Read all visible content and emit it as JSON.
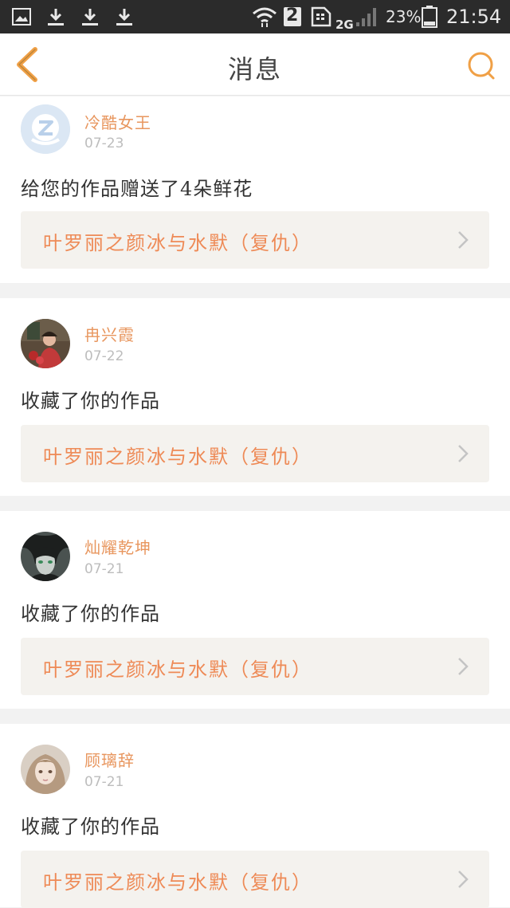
{
  "status_bar": {
    "battery_percent": "23%",
    "time": "21:54",
    "sim_slot": "2",
    "network": "2G",
    "icons": [
      "image-icon",
      "download-icon",
      "download-icon",
      "download-icon",
      "wifi-icon",
      "sim-icon",
      "signal-icon",
      "battery-icon"
    ]
  },
  "header": {
    "title": "消息",
    "back_icon": "chevron-left-icon",
    "search_icon": "search-icon",
    "accent_color": "#f0a046"
  },
  "messages": [
    {
      "username": "冷酷女王",
      "date": "07-23",
      "action": "给您的作品赠送了4朵鲜花",
      "work_title": "叶罗丽之颜冰与水默（复仇）",
      "avatar": "default-avatar-icon"
    },
    {
      "username": "冉兴霞",
      "date": "07-22",
      "action": "收藏了你的作品",
      "work_title": "叶罗丽之颜冰与水默（复仇）",
      "avatar": "user-photo-avatar"
    },
    {
      "username": "灿耀乾坤",
      "date": "07-21",
      "action": "收藏了你的作品",
      "work_title": "叶罗丽之颜冰与水默（复仇）",
      "avatar": "anime-avatar"
    },
    {
      "username": "顾璃辞",
      "date": "07-21",
      "action": "收藏了你的作品",
      "work_title": "叶罗丽之颜冰与水默（复仇）",
      "avatar": "anime-girl-avatar"
    }
  ],
  "colors": {
    "username": "#e8965e",
    "work_title": "#ee8a56",
    "date": "#bdbdbd",
    "work_bg": "#f4f2ee"
  }
}
